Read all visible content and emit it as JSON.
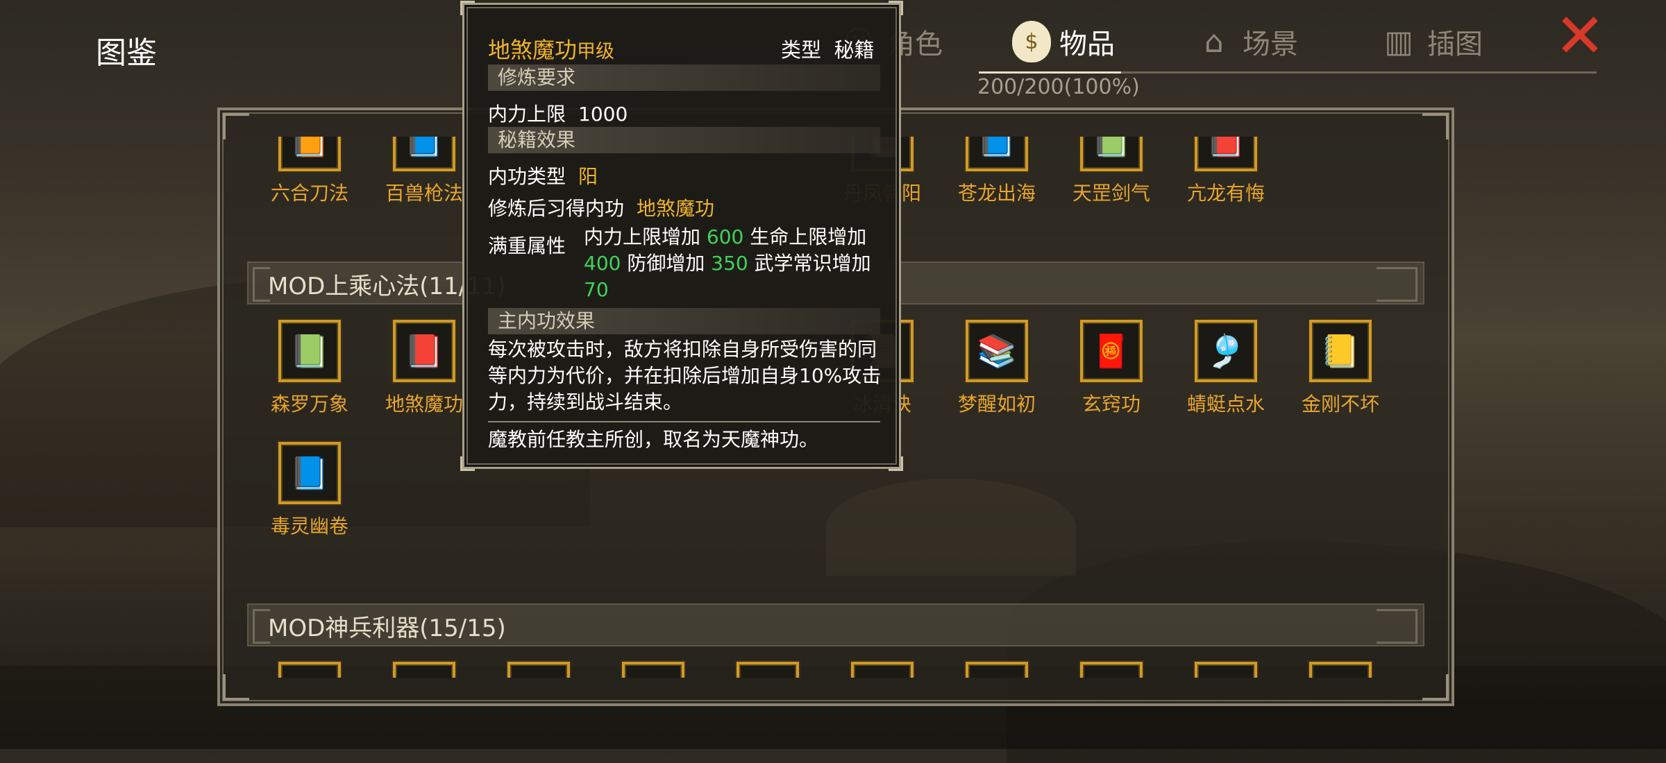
{
  "header": {
    "title": "图鉴",
    "tabs": [
      {
        "label": "角色",
        "icon": "character-icon"
      },
      {
        "label": "物品",
        "icon": "item-bag-icon"
      },
      {
        "label": "场景",
        "icon": "scene-pagoda-icon"
      },
      {
        "label": "插图",
        "icon": "illustration-icon"
      }
    ],
    "active_tab": "物品",
    "progress": "200/200(100%)",
    "close_icon": "close-x-icon"
  },
  "row_top": [
    "六合刀法",
    "百兽枪法",
    "",
    "",
    "",
    "丹凤朝阳",
    "苍龙出海",
    "天罡剑气",
    "亢龙有悔"
  ],
  "section1": {
    "title": "MOD上乘心法(11/11)",
    "items": [
      "森罗万象",
      "地煞魔功",
      "",
      "",
      "",
      "冰清诀",
      "梦醒如初",
      "玄窍功",
      "蜻蜓点水",
      "金刚不坏",
      "毒灵幽卷"
    ]
  },
  "section2": {
    "title": "MOD神兵利器(15/15)"
  },
  "tooltip": {
    "name": "地煞魔功",
    "grade": "甲级",
    "type_label": "类型",
    "type_value": "秘籍",
    "req_header": "修炼要求",
    "req_label": "内力上限",
    "req_value": "1000",
    "effect_header": "秘籍效果",
    "neigong_type_label": "内功类型",
    "neigong_type_value": "阳",
    "learn_label": "修炼后习得内功",
    "learn_value": "地煞魔功",
    "full_label": "满重属性",
    "full_attrs": [
      {
        "label": "内力上限增加",
        "value": "600"
      },
      {
        "label": "生命上限增加",
        "value": "400"
      },
      {
        "label": "防御增加",
        "value": "350"
      },
      {
        "label": "武学常识增加",
        "value": "70"
      }
    ],
    "main_header": "主内功效果",
    "main_effect": "每次被攻击时，敌方将扣除自身所受伤害的同等内力为代价，并在扣除后增加自身10%攻击力，持续到战斗结束。",
    "lore": "魔教前任教主所创，取名为天魔神功。"
  },
  "colors": {
    "gold": "#f0b429",
    "item_name": "#e8a52a",
    "green": "#3ed35a",
    "close": "#d63a2a"
  }
}
